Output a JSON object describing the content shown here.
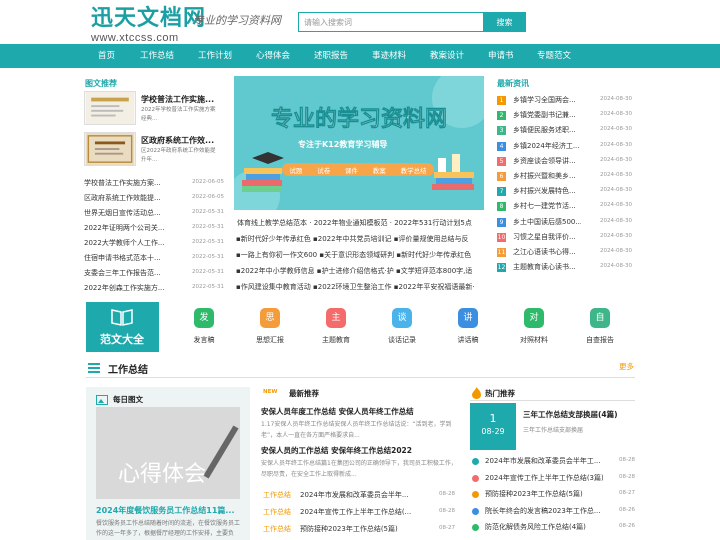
{
  "header": {
    "logo_title": "迅天文档网",
    "logo_url": "www.xtccss.com",
    "slogan": "专业的学习资料网",
    "search_placeholder": "请输入搜索词",
    "search_button": "搜索"
  },
  "nav": [
    "首页",
    "工作总结",
    "工作计划",
    "心得体会",
    "述职报告",
    "事迹材料",
    "教案设计",
    "申请书",
    "专题范文"
  ],
  "featured": {
    "heading": "图文推荐",
    "cards": [
      {
        "title": "学校普法工作实施...",
        "desc": "2022年学校普法工作实施方案经典..."
      },
      {
        "title": "区政府系统工作效...",
        "desc": "区2022年政府系统工作效能提升年..."
      }
    ],
    "list": [
      {
        "title": "学校普法工作实施方案...",
        "date": "2022-06-05"
      },
      {
        "title": "区政府系统工作效能提...",
        "date": "2022-06-05"
      },
      {
        "title": "世界无烟日宣传活动总...",
        "date": "2022-05-31"
      },
      {
        "title": "2022年证明两个公司关...",
        "date": "2022-05-31"
      },
      {
        "title": "2022大学教师个人工作...",
        "date": "2022-05-31"
      },
      {
        "title": "住宿申请书格式范本十...",
        "date": "2022-05-31"
      },
      {
        "title": "支委会三年工作报告范...",
        "date": "2022-05-31"
      },
      {
        "title": "2022年创森工作实施方...",
        "date": "2022-05-31"
      }
    ]
  },
  "banner": {
    "title": "专业的学习资料网",
    "subtitle": "专注于K12教育学习辅导",
    "tags": [
      "试题",
      "试卷",
      "课件",
      "教案",
      "教学总结"
    ]
  },
  "middle_links": [
    [
      "体育线上教学总结范本",
      "2022年物业通知模板范",
      "2022年531行动计划5点"
    ],
    [
      "新时代好少年传承红色",
      "2022年中共党员培训记",
      "评价量规使用总结与反"
    ],
    [
      "一路上有你初一作文600",
      "关于意识形态领域研判",
      "新时代好少年传承红色"
    ],
    [
      "2022年中小学教师信息",
      "护士进修介绍信格式·护",
      "文学短评范本800字,适"
    ],
    [
      "作风建设集中教育活动",
      "2022环境卫生整治工作",
      "2022年平安祝福语最新·"
    ]
  ],
  "latest": {
    "heading": "最新资讯",
    "items": [
      {
        "n": "1",
        "title": "乡镇学习全国两会...",
        "date": "2024-08-30"
      },
      {
        "n": "2",
        "title": "乡镇党委副书记兼...",
        "date": "2024-08-30"
      },
      {
        "n": "3",
        "title": "乡镇便民服务述职...",
        "date": "2024-08-30"
      },
      {
        "n": "4",
        "title": "乡镇2024年经济工...",
        "date": "2024-08-30"
      },
      {
        "n": "5",
        "title": "乡资座谈会领导讲...",
        "date": "2024-08-30"
      },
      {
        "n": "6",
        "title": "乡村振兴暨和美乡...",
        "date": "2024-08-30"
      },
      {
        "n": "7",
        "title": "乡村振兴发展特色...",
        "date": "2024-08-30"
      },
      {
        "n": "8",
        "title": "乡村七一建党节活...",
        "date": "2024-08-30"
      },
      {
        "n": "9",
        "title": "乡土中国读后感500...",
        "date": "2024-08-30"
      },
      {
        "n": "10",
        "title": "习惯之星自我评价...",
        "date": "2024-08-30"
      },
      {
        "n": "11",
        "title": "之江心语读书心得...",
        "date": "2024-08-30"
      },
      {
        "n": "12",
        "title": "主题教育读心读书...",
        "date": "2024-08-30"
      }
    ]
  },
  "categories": {
    "main_label": "范文大全",
    "items": [
      {
        "char": "发",
        "label": "发言稿",
        "color": "#2fba6b"
      },
      {
        "char": "思",
        "label": "思想汇报",
        "color": "#f49b3a"
      },
      {
        "char": "主",
        "label": "主题教育",
        "color": "#f46b6b"
      },
      {
        "char": "谈",
        "label": "谈话记录",
        "color": "#4bb3ea"
      },
      {
        "char": "讲",
        "label": "讲话稿",
        "color": "#3c8ee0"
      },
      {
        "char": "对",
        "label": "对照材料",
        "color": "#2fba6b"
      },
      {
        "char": "自",
        "label": "自查报告",
        "color": "#3fb58a"
      }
    ]
  },
  "work_summary": {
    "title": "工作总结",
    "more": "更多",
    "daily": {
      "heading": "每日图文",
      "image_text": "心得体会",
      "title": "2024年度餐饮服务员工作总结11篇...",
      "desc": "餐饮服务员工作总结随着时间的流逝，在餐饮服务员工作的这一年多了，根据餐厅经理的工作安排，主要负责..."
    },
    "recommend": {
      "badge": "NEW",
      "heading": "最新推荐",
      "articles": [
        {
          "title": "安保人员年度工作总结 安保人员年终工作总结",
          "desc": "1.17安保人员年终工作总结安保人员年终工作总结话说：“活到老，学到老”，本人一直在各方面严格要求自..."
        },
        {
          "title": "安保人员的工作总结 安保年终工作总结2022",
          "desc": "安保人员年终工作总结篇1在集团公司的正确领导下，我司员工积极工作，尽职尽责，在安全工作上取得新成..."
        }
      ],
      "rows": [
        {
          "tag": "工作总结",
          "title": "2024年市发展和改革委员会半年...",
          "date": "08-28"
        },
        {
          "tag": "工作总结",
          "title": "2024年宣传工作上半年工作总结(...",
          "date": "08-28"
        },
        {
          "tag": "工作总结",
          "title": "预防接种2023年工作总结(5篇)",
          "date": "08-27"
        }
      ]
    },
    "hot": {
      "heading": "热门推荐",
      "day": "1",
      "md": "08-29",
      "title": "三年工作总结支部换届(4篇)",
      "desc": "三年工作总结支部换届",
      "rows": [
        {
          "title": "2024年市发展和改革委员会半年工...",
          "date": "08-28"
        },
        {
          "title": "2024年宣传工作上半年工作总结(3篇)",
          "date": "08-28"
        },
        {
          "title": "预防接种2023年工作总结(5篇)",
          "date": "08-27"
        },
        {
          "title": "院长年终会的发言稿2023年工作总...",
          "date": "08-26"
        },
        {
          "title": "防范化解债务风险工作总结(4篇)",
          "date": "08-26"
        }
      ]
    }
  }
}
